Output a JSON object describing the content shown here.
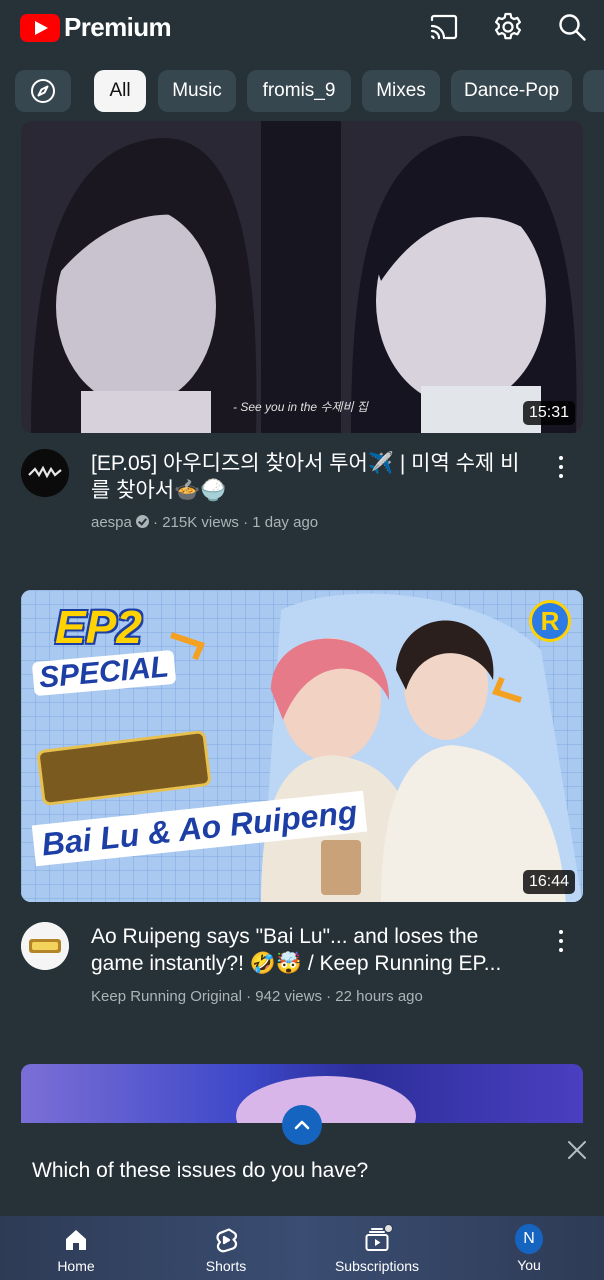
{
  "header": {
    "logo_text": "Premium",
    "icons": [
      "cast-icon",
      "settings-gear-icon",
      "search-icon"
    ]
  },
  "chips": {
    "explore_icon": "compass-icon",
    "items": [
      "All",
      "Music",
      "fromis_9",
      "Mixes",
      "Dance-Pop"
    ]
  },
  "videos": [
    {
      "title": "[EP.05] 아우디즈의 찾아서 투어✈️ | 미역 수제 비를 찾아서🍲🍚",
      "channel": "aespa",
      "verified": true,
      "meta": " · 215K views · 1 day ago",
      "duration": "15:31",
      "thumb_caption": "- See you in the 수제비 집"
    },
    {
      "title": "Ao Ruipeng says \"Bai Lu\"... and loses the game instantly?! 🤣🤯 / Keep Running EP...",
      "channel": "Keep Running Original",
      "verified": false,
      "meta": " · 942 views · 22 hours ago",
      "duration": "16:44",
      "thumb_text": {
        "ep": "EP2",
        "special": "SPECIAL",
        "names": "Bai Lu & Ao Ruipeng",
        "badge": "R"
      }
    }
  ],
  "sheet": {
    "question": "Which of these issues do you have?"
  },
  "bottom_nav": {
    "items": [
      {
        "label": "Home",
        "icon": "home-icon"
      },
      {
        "label": "Shorts",
        "icon": "shorts-icon"
      },
      {
        "label": "Subscriptions",
        "icon": "subscriptions-icon"
      },
      {
        "label": "You",
        "icon": "avatar",
        "initial": "N"
      }
    ]
  },
  "colors": {
    "background": "#263238",
    "chip": "#37474f",
    "chip_active": "#f5f5f5",
    "brand_red": "#ff0000",
    "accent_blue": "#1565c0"
  }
}
